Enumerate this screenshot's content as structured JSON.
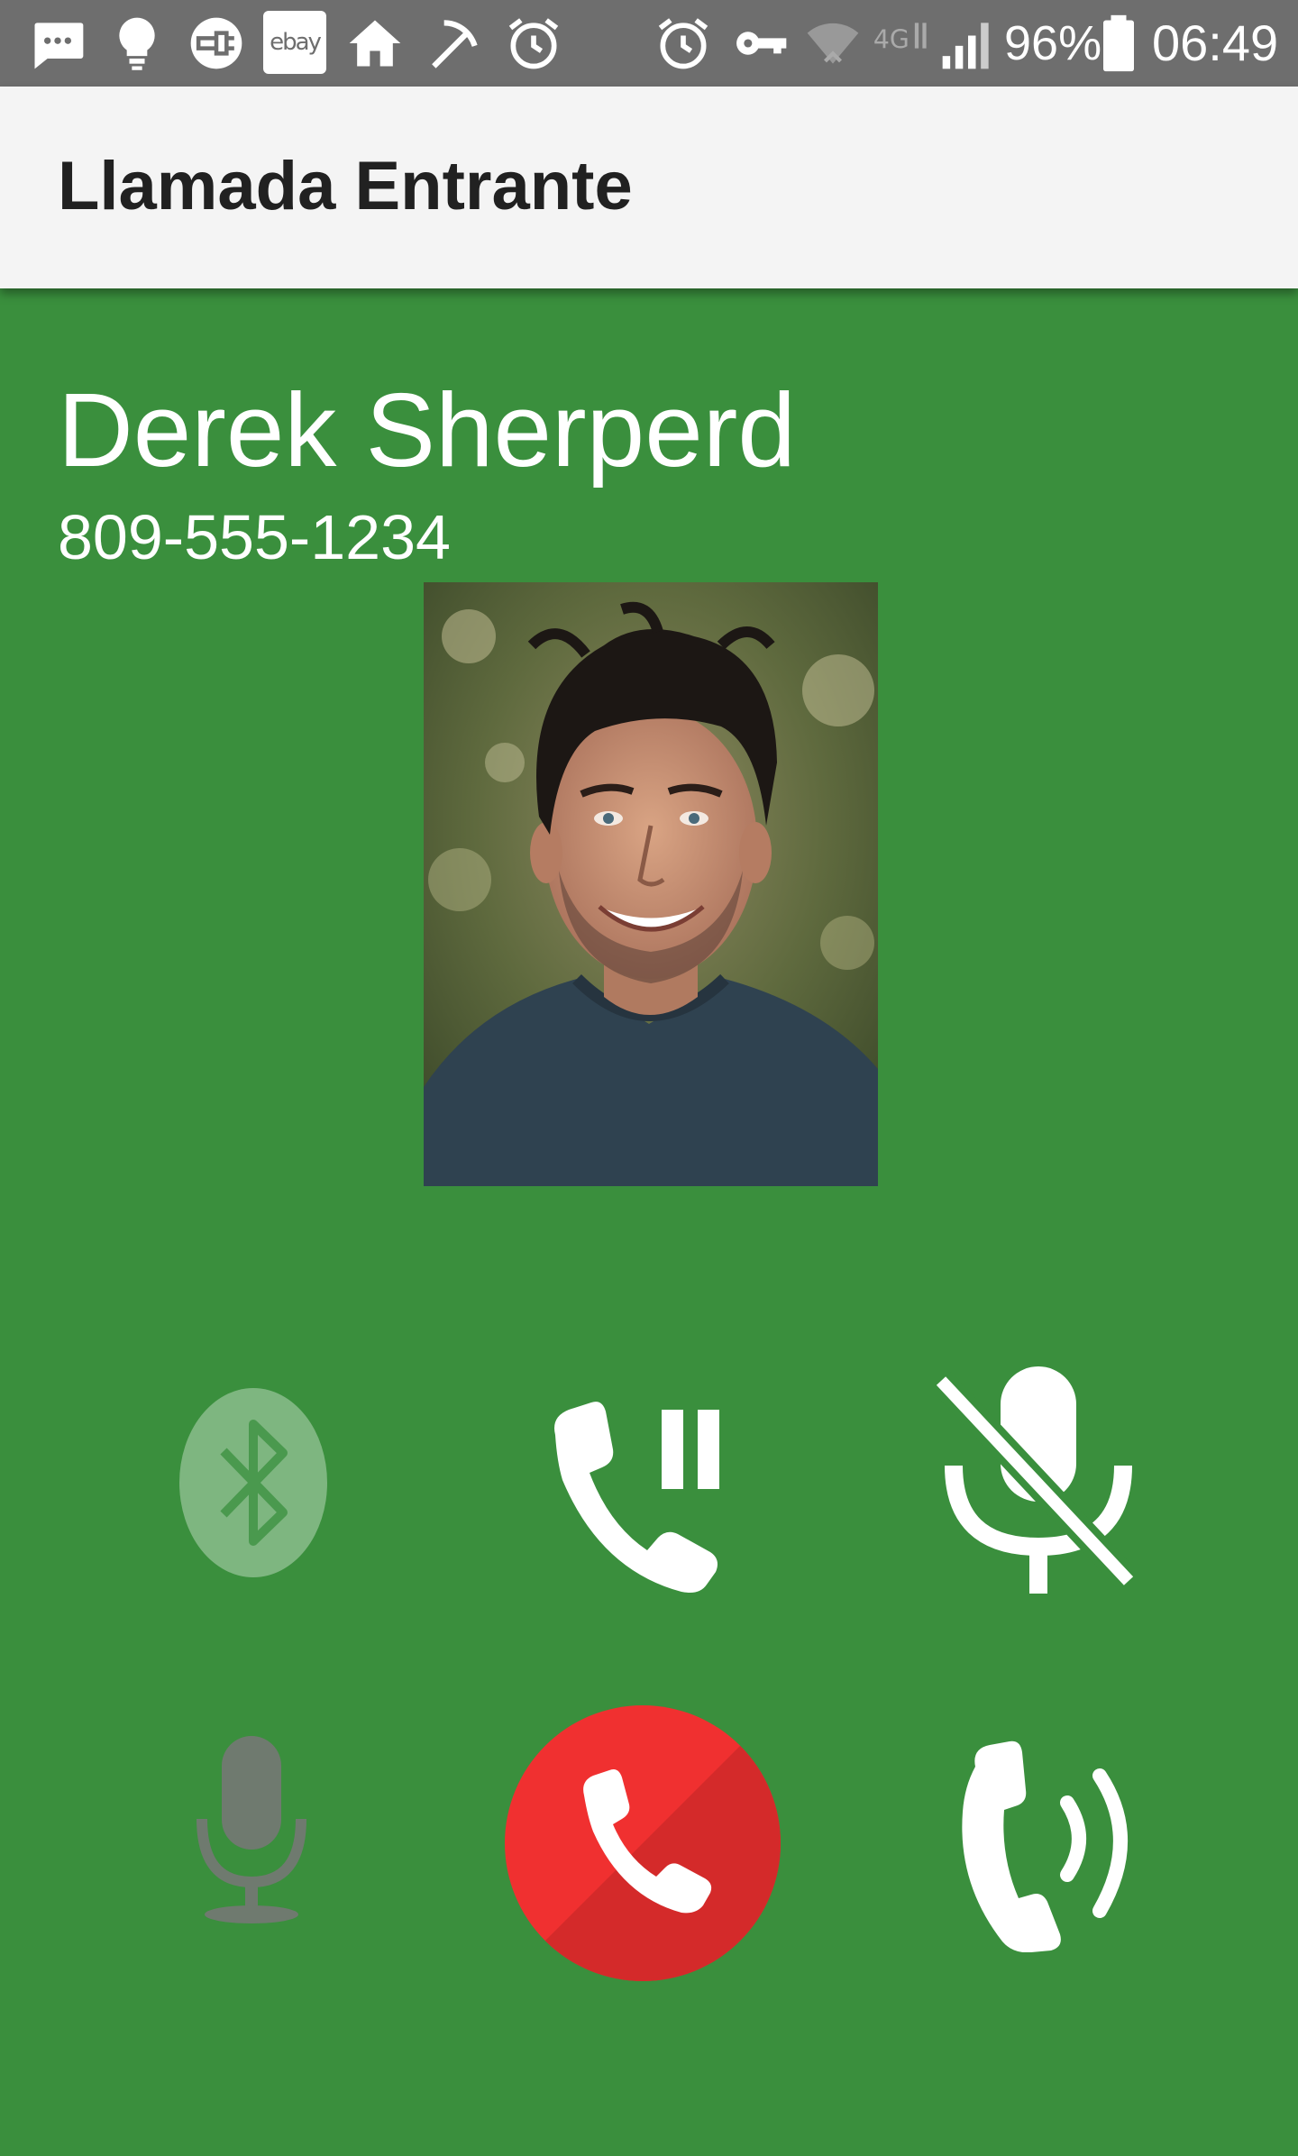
{
  "status_bar": {
    "icons": [
      "message-icon",
      "lightbulb-icon",
      "plug-icon",
      "ebay-icon",
      "home-icon",
      "pickaxe-icon",
      "alarm-icon",
      "alarm-icon",
      "vpn-key-icon",
      "wifi-icon",
      "lte-icon",
      "signal-icon",
      "battery-icon"
    ],
    "ebay_label": "ebay",
    "battery_percent": "96%",
    "time": "06:49"
  },
  "app_bar": {
    "title": "Llamada Entrante"
  },
  "caller": {
    "name": "Derek Sherperd",
    "number": "809-555-1234",
    "photo": "caller-photo"
  },
  "controls": {
    "row1": [
      "bluetooth-icon",
      "hold-call-icon",
      "mute-microphone-icon"
    ],
    "row2": [
      "microphone-icon",
      "end-call-icon",
      "speaker-call-icon"
    ]
  },
  "colors": {
    "background": "#3a8f3d",
    "status_bar": "#6e6e6e",
    "app_bar": "#f4f4f4",
    "end_call": "#f03030",
    "icon_white": "#ffffff"
  }
}
